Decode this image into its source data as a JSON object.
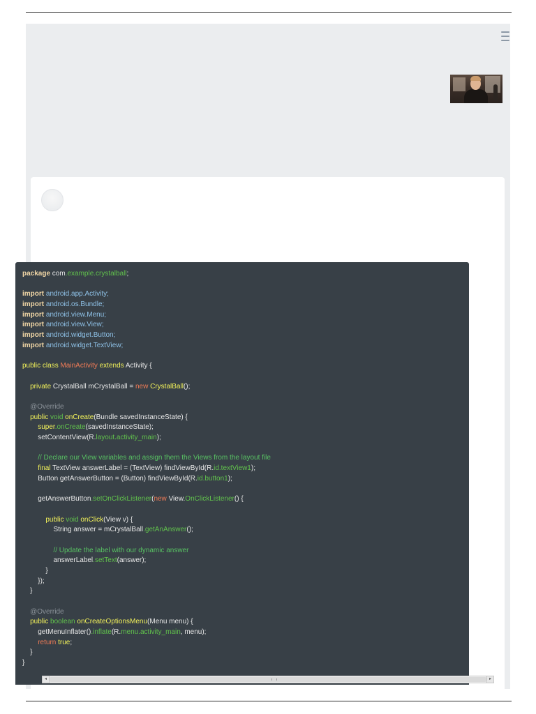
{
  "page": {
    "background": "#ffffff",
    "frame_background": "#ebedef",
    "code_background": "#384047"
  },
  "header": {
    "menu_icon": "hamburger-icon",
    "video_thumbnail": "presenter-video-thumbnail"
  },
  "card": {
    "avatar": "user-avatar"
  },
  "code": {
    "colors": {
      "keyword": "#f2d7a6",
      "type": "#f3f25a",
      "new": "#f07b56",
      "member": "#61c24c",
      "comment": "#58c263",
      "annotation": "#8b9299",
      "package": "#8fc2e8"
    },
    "lines": [
      [
        {
          "t": "package",
          "c": "kw"
        },
        {
          "t": " com",
          "c": "d"
        },
        {
          "t": ".example.crystalball",
          "c": "g"
        },
        {
          "t": ";",
          "c": "d"
        }
      ],
      [],
      [
        {
          "t": "import",
          "c": "kw"
        },
        {
          "t": " android.app.Activity;",
          "c": "ns"
        }
      ],
      [
        {
          "t": "import",
          "c": "kw"
        },
        {
          "t": " android.os.Bundle;",
          "c": "ns"
        }
      ],
      [
        {
          "t": "import",
          "c": "kw"
        },
        {
          "t": " android.view.Menu;",
          "c": "ns"
        }
      ],
      [
        {
          "t": "import",
          "c": "kw"
        },
        {
          "t": " android.view.View;",
          "c": "ns"
        }
      ],
      [
        {
          "t": "import",
          "c": "kw"
        },
        {
          "t": " android.widget.Button;",
          "c": "ns"
        }
      ],
      [
        {
          "t": "import",
          "c": "kw"
        },
        {
          "t": " android.widget.TextView;",
          "c": "ns"
        }
      ],
      [],
      [
        {
          "t": "public class ",
          "c": "y"
        },
        {
          "t": "MainActivity",
          "c": "o"
        },
        {
          "t": " extends ",
          "c": "y"
        },
        {
          "t": "Activity {",
          "c": "d"
        }
      ],
      [],
      [
        {
          "t": "    private ",
          "c": "y"
        },
        {
          "t": "CrystalBall mCrystalBall = ",
          "c": "d"
        },
        {
          "t": "new ",
          "c": "o"
        },
        {
          "t": "CrystalBall",
          "c": "y"
        },
        {
          "t": "();",
          "c": "d"
        }
      ],
      [],
      [
        {
          "t": "    @Override",
          "c": "m"
        }
      ],
      [
        {
          "t": "    public ",
          "c": "y"
        },
        {
          "t": "void ",
          "c": "g"
        },
        {
          "t": "onCreate",
          "c": "y"
        },
        {
          "t": "(Bundle savedInstanceState) {",
          "c": "d"
        }
      ],
      [
        {
          "t": "        super",
          "c": "y"
        },
        {
          "t": ".onCreate",
          "c": "g"
        },
        {
          "t": "(savedInstanceState);",
          "c": "d"
        }
      ],
      [
        {
          "t": "        setContentView(R.",
          "c": "d"
        },
        {
          "t": "layout.activity_main",
          "c": "g"
        },
        {
          "t": ");",
          "c": "d"
        }
      ],
      [],
      [
        {
          "t": "        // Declare our View variables and assign them the Views from the layout file",
          "c": "c"
        }
      ],
      [
        {
          "t": "        final ",
          "c": "y"
        },
        {
          "t": "TextView answerLabel = (TextView) findViewById(R.",
          "c": "d"
        },
        {
          "t": "id.textView1",
          "c": "g"
        },
        {
          "t": ");",
          "c": "d"
        }
      ],
      [
        {
          "t": "        Button getAnswerButton = (Button) findViewById(R.",
          "c": "d"
        },
        {
          "t": "id.button1",
          "c": "g"
        },
        {
          "t": ");",
          "c": "d"
        }
      ],
      [],
      [
        {
          "t": "        getAnswerButton",
          "c": "d"
        },
        {
          "t": ".setOnClickListener",
          "c": "g"
        },
        {
          "t": "(",
          "c": "d"
        },
        {
          "t": "new ",
          "c": "o"
        },
        {
          "t": "View.",
          "c": "d"
        },
        {
          "t": "OnClickListener",
          "c": "g"
        },
        {
          "t": "() {",
          "c": "d"
        }
      ],
      [],
      [
        {
          "t": "            public ",
          "c": "y"
        },
        {
          "t": "void ",
          "c": "g"
        },
        {
          "t": "onClick",
          "c": "y"
        },
        {
          "t": "(View v) {",
          "c": "d"
        }
      ],
      [
        {
          "t": "                String answer = mCrystalBall",
          "c": "d"
        },
        {
          "t": ".getAnAnswer",
          "c": "g"
        },
        {
          "t": "();",
          "c": "d"
        }
      ],
      [],
      [
        {
          "t": "                // Update the label with our dynamic answer",
          "c": "c"
        }
      ],
      [
        {
          "t": "                answerLabel",
          "c": "d"
        },
        {
          "t": ".setText",
          "c": "g"
        },
        {
          "t": "(answer);",
          "c": "d"
        }
      ],
      [
        {
          "t": "            }",
          "c": "d"
        }
      ],
      [
        {
          "t": "        });",
          "c": "d"
        }
      ],
      [
        {
          "t": "    }",
          "c": "d"
        }
      ],
      [],
      [
        {
          "t": "    @Override",
          "c": "m"
        }
      ],
      [
        {
          "t": "    public ",
          "c": "y"
        },
        {
          "t": "boolean ",
          "c": "g"
        },
        {
          "t": "onCreateOptionsMenu",
          "c": "y"
        },
        {
          "t": "(Menu menu) {",
          "c": "d"
        }
      ],
      [
        {
          "t": "        getMenuInflater()",
          "c": "d"
        },
        {
          "t": ".inflate",
          "c": "g"
        },
        {
          "t": "(R.",
          "c": "d"
        },
        {
          "t": "menu.activity_main",
          "c": "g"
        },
        {
          "t": ", menu);",
          "c": "d"
        }
      ],
      [
        {
          "t": "        return ",
          "c": "o"
        },
        {
          "t": "true",
          "c": "y"
        },
        {
          "t": ";",
          "c": "d"
        }
      ],
      [
        {
          "t": "    }",
          "c": "d"
        }
      ],
      [
        {
          "t": "}",
          "c": "d"
        }
      ]
    ]
  },
  "scrollbar": {
    "left_arrow": "◂",
    "right_arrow": "▸"
  }
}
